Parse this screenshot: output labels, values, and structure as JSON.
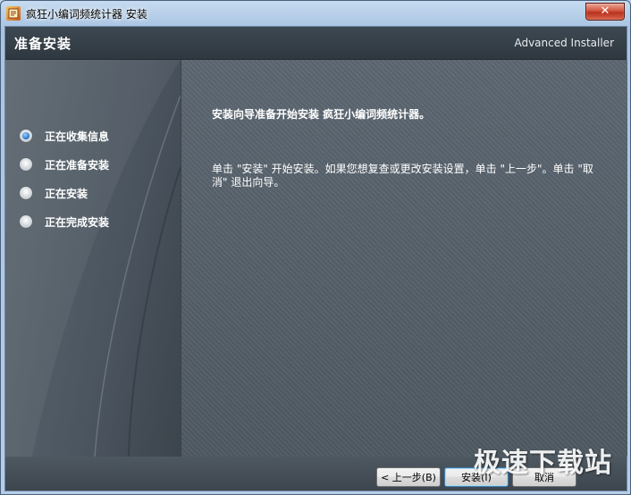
{
  "window": {
    "title": "疯狂小编词频统计器 安装",
    "close_label": "✕"
  },
  "header": {
    "title": "准备安装",
    "brand": "Advanced Installer"
  },
  "steps": [
    {
      "label": "正在收集信息",
      "state": "current"
    },
    {
      "label": "正在准备安装",
      "state": "pending"
    },
    {
      "label": "正在安装",
      "state": "pending"
    },
    {
      "label": "正在完成安装",
      "state": "pending"
    }
  ],
  "main": {
    "heading": "安装向导准备开始安装 疯狂小编词频统计器。",
    "body": "单击 \"安装\" 开始安装。如果您想复查或更改安装设置，单击 \"上一步\"。单击 \"取消\" 退出向导。"
  },
  "footer": {
    "back_label": "< 上一步(B)",
    "install_label": "安装(I)",
    "cancel_label": "取消"
  },
  "watermark": "极速下载站",
  "colors": {
    "header_bg": "#343e46",
    "panel_bg": "#56616b",
    "active_radio": "#1f6fc4"
  }
}
